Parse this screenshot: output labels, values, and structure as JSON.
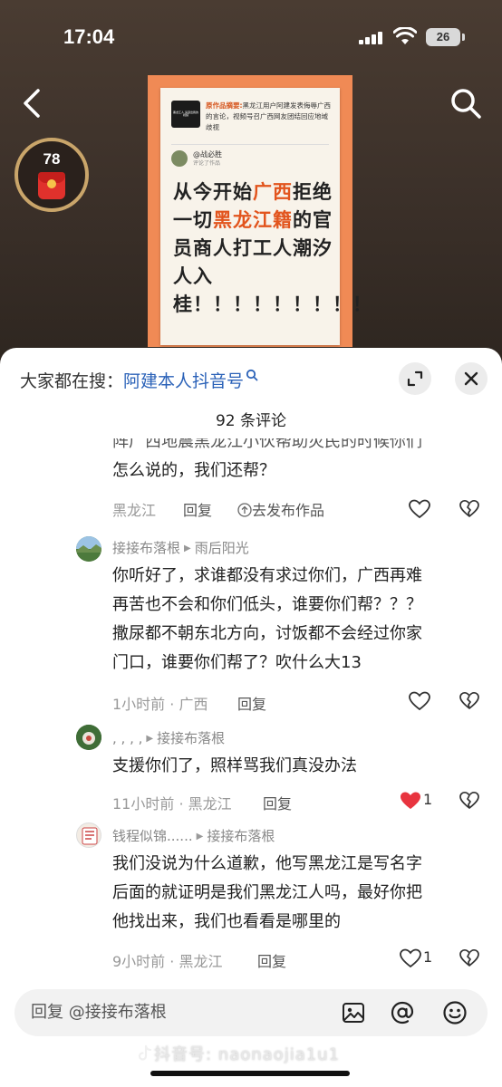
{
  "status": {
    "time": "17:04",
    "battery": "26"
  },
  "red_packet": {
    "count": "78"
  },
  "poster": {
    "summary_label": "原作品摘要:",
    "summary_text": "黑龙江用户阿建发表侮辱广西的言论，视频号召广西网友团结回应地域歧视",
    "thumb_text": "黑龙江人 请滚出我的视频",
    "username": "@战必胜",
    "user_sub": "评论了作品",
    "headline_parts": [
      {
        "text": "从今开始",
        "hl": false
      },
      {
        "text": "广西",
        "hl": true
      },
      {
        "text": "拒绝一切",
        "hl": false
      },
      {
        "text": "黑龙江籍",
        "hl": true
      },
      {
        "text": "的官员商人打工人潮汐人入桂！！！！！！！！！",
        "hl": false
      }
    ]
  },
  "search": {
    "prefix": "大家都在搜：",
    "term": "阿建本人抖音号"
  },
  "sheet_title": "92 条评论",
  "comments": [
    {
      "id": "c0",
      "lines": [
        "阵广西地震黑龙江小伙帮助灾民的时候你们",
        "怎么说的，我们还帮？"
      ],
      "meta": "黑龙江",
      "reply": "回复",
      "publish": "去发布作品",
      "like_count": ""
    },
    {
      "id": "c1",
      "author": "接接布落根",
      "reply_to": "雨后阳光",
      "lines": [
        "你听好了，求谁都没有求过你们，广西再难",
        "再苦也不会和你们低头，谁要你们帮？？？",
        "撒尿都不朝东北方向，讨饭都不会经过你家",
        "门口，谁要你们帮了？吹什么大13"
      ],
      "meta": "1小时前 · 广西",
      "reply": "回复",
      "like_count": ""
    },
    {
      "id": "c2",
      "author": ", , , ,",
      "reply_to": "接接布落根",
      "lines": [
        "支援你们了，照样骂我们真没办法"
      ],
      "meta": "11小时前 · 黑龙江",
      "reply": "回复",
      "like_count": "1",
      "liked": true
    },
    {
      "id": "c3",
      "author": "钱程似锦......",
      "reply_to": "接接布落根",
      "lines": [
        "我们没说为什么道歉，他写黑龙江是写名字",
        "后面的就证明是我们黑龙江人吗，最好你把",
        "他找出来，我们也看看是哪里的"
      ],
      "meta": "9小时前 · 黑龙江",
      "reply": "回复",
      "like_count": "1",
      "liked": false
    }
  ],
  "input": {
    "placeholder": "回复 @接接布落根"
  },
  "watermark": "抖音号: naonaojia1u1",
  "icons": {
    "back": "back-chevron-icon",
    "search": "search-icon",
    "expand": "expand-icon",
    "close": "close-icon",
    "like": "heart-icon",
    "dislike": "broken-heart-icon",
    "image": "image-icon",
    "mention": "at-icon",
    "emoji": "emoji-icon"
  },
  "colors": {
    "accent_red": "#e8343f",
    "link_blue": "#2b62b8",
    "poster_orange": "#f08a55",
    "headline_highlight": "#e2541d"
  }
}
